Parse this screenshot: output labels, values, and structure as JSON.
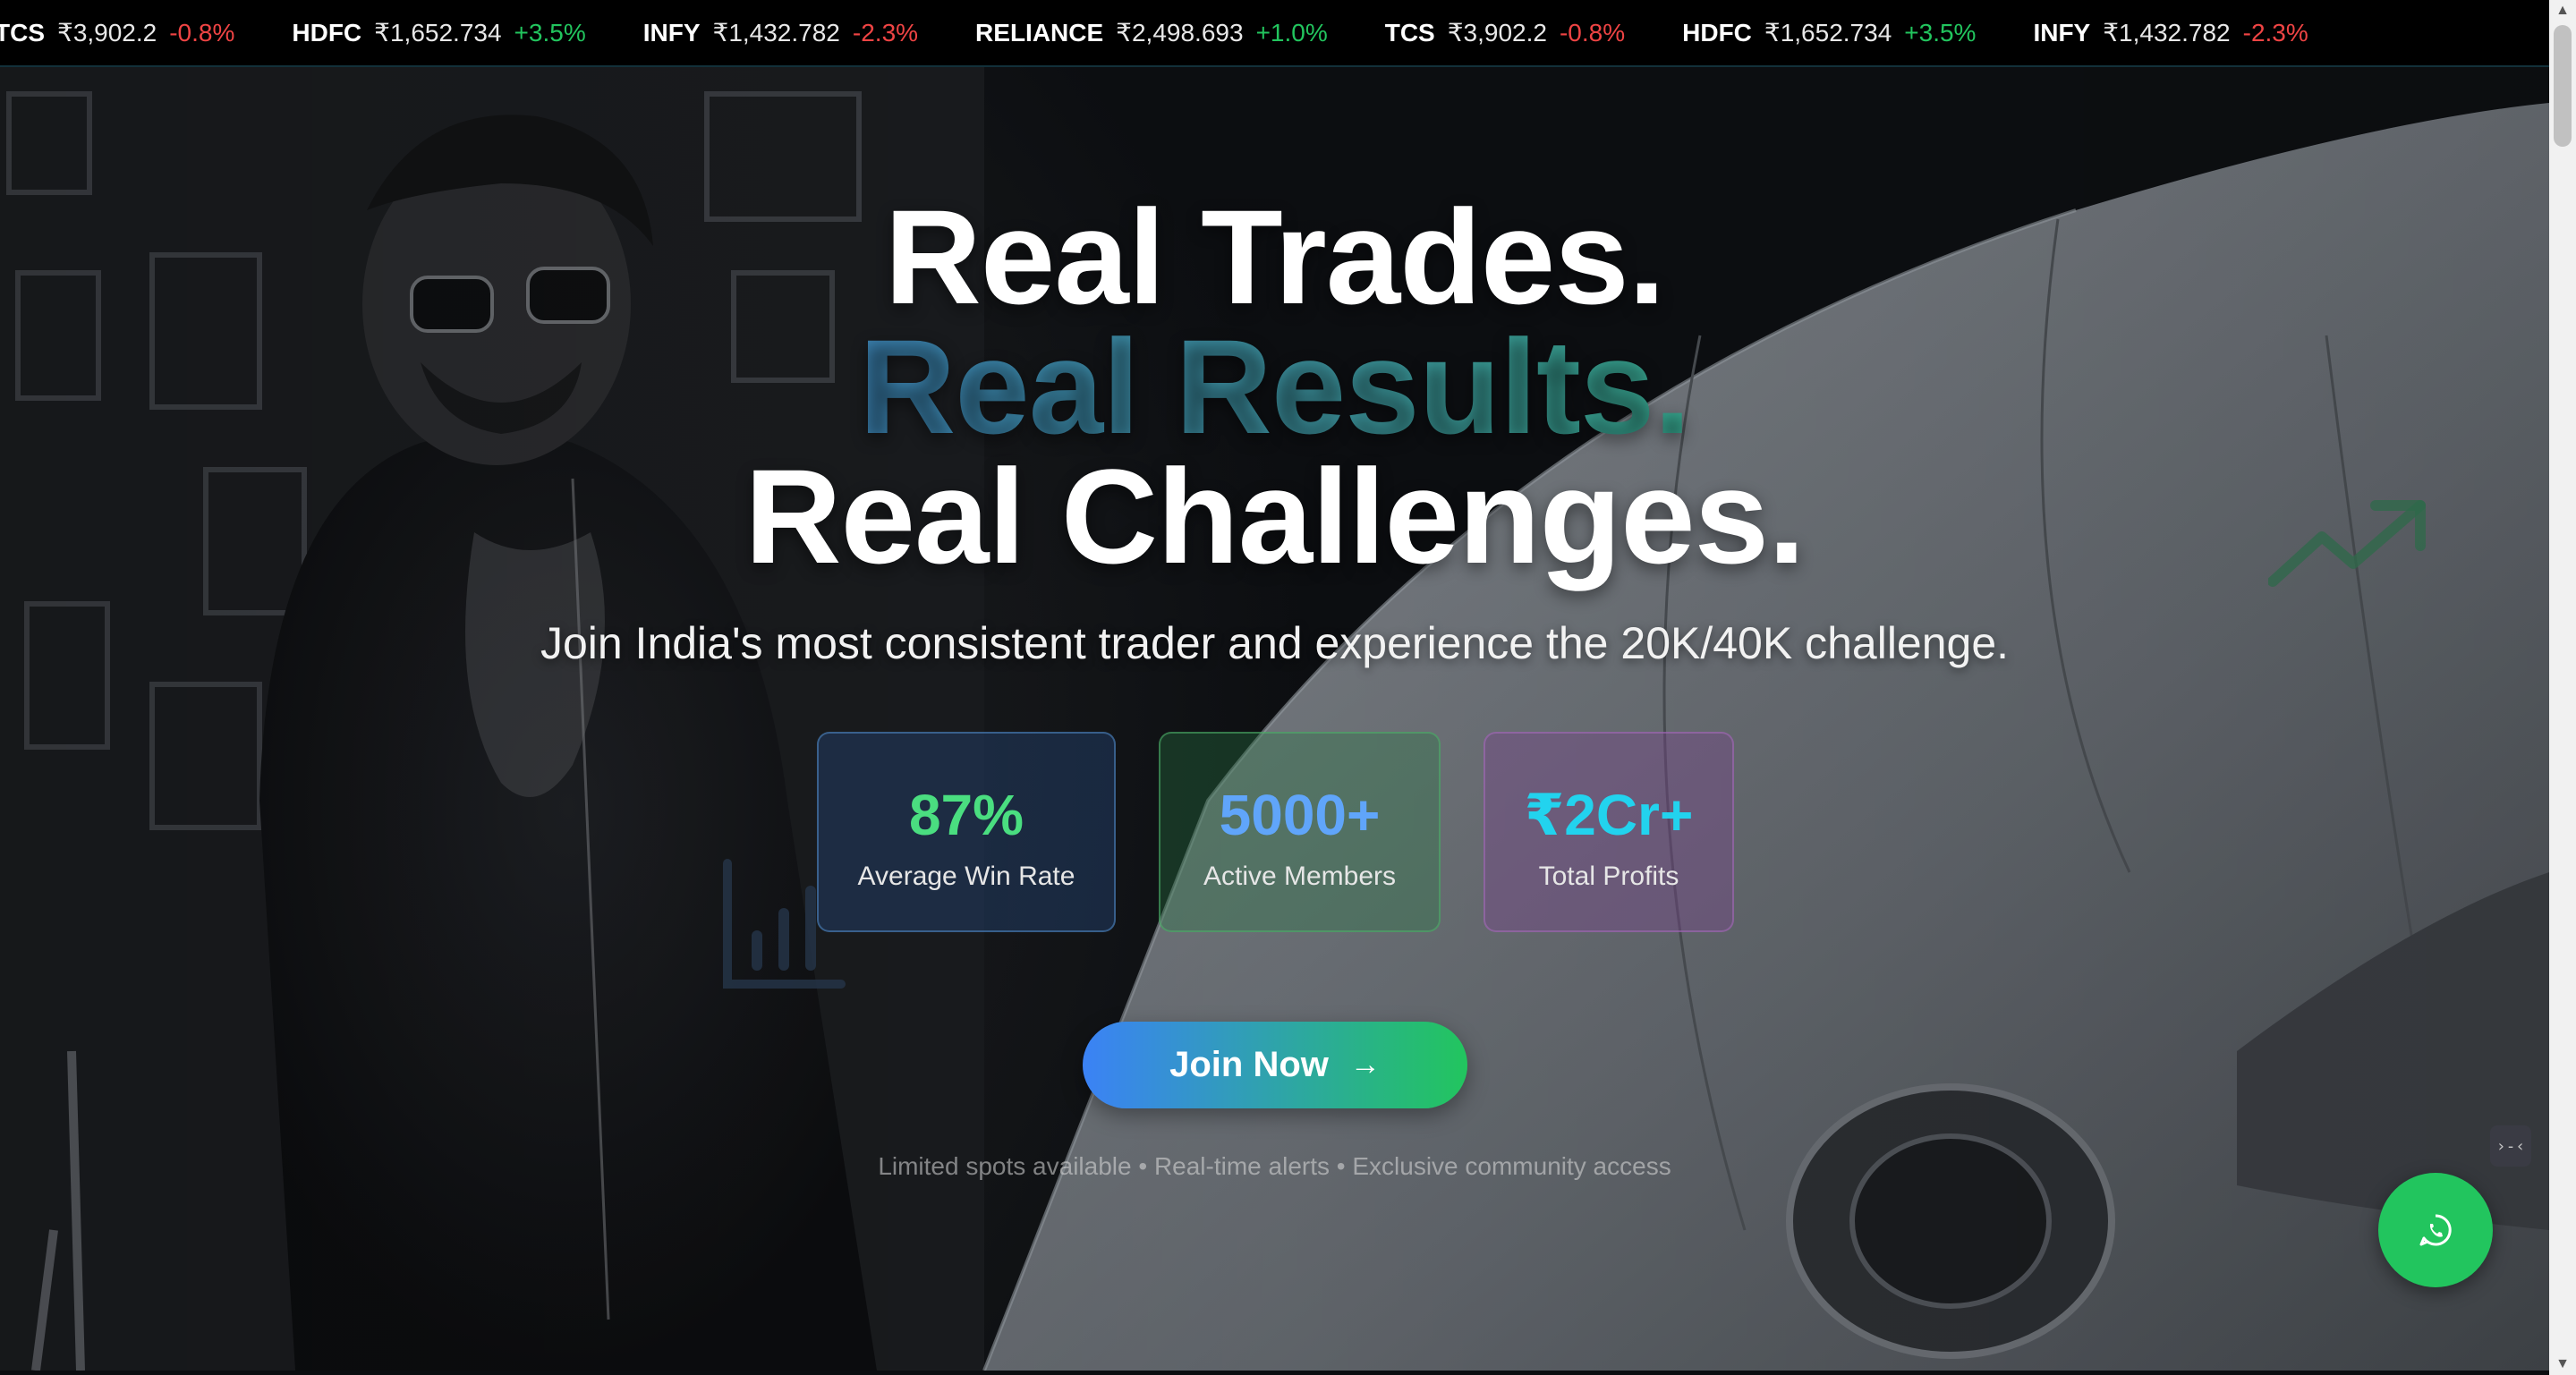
{
  "ticker": {
    "items": [
      {
        "symbol": "TCS",
        "price": "₹3,902.2",
        "change": "-0.8%",
        "direction": "down"
      },
      {
        "symbol": "HDFC",
        "price": "₹1,652.734",
        "change": "+3.5%",
        "direction": "up"
      },
      {
        "symbol": "INFY",
        "price": "₹1,432.782",
        "change": "-2.3%",
        "direction": "down"
      },
      {
        "symbol": "RELIANCE",
        "price": "₹2,498.693",
        "change": "+1.0%",
        "direction": "up"
      },
      {
        "symbol": "TCS",
        "price": "₹3,902.2",
        "change": "-0.8%",
        "direction": "down"
      },
      {
        "symbol": "HDFC",
        "price": "₹1,652.734",
        "change": "+3.5%",
        "direction": "up"
      },
      {
        "symbol": "INFY",
        "price": "₹1,432.782",
        "change": "-2.3%",
        "direction": "down"
      }
    ],
    "colors": {
      "up": "#22c55e",
      "down": "#ef4444"
    }
  },
  "hero": {
    "headline_line1": "Real Trades.",
    "headline_line2": "Real Results.",
    "headline_line3": "Real Challenges.",
    "subheadline": "Join India's most consistent trader and experience the 20K/40K challenge.",
    "stats": [
      {
        "value": "87%",
        "label": "Average Win Rate",
        "color": "#4ade80"
      },
      {
        "value": "5000+",
        "label": "Active Members",
        "color": "#60a5fa"
      },
      {
        "value": "₹2Cr+",
        "label": "Total Profits",
        "color": "#22d3ee"
      }
    ],
    "cta": {
      "label": "Join Now",
      "icon": "arrow-right-icon"
    },
    "footnote": "Limited spots available • Real-time alerts • Exclusive community access"
  },
  "floating": {
    "whatsapp_icon": "whatsapp-icon",
    "code_badge": "›-‹"
  },
  "decor_icons": [
    "trending-up-icon",
    "bar-chart-icon"
  ],
  "theme": {
    "accent_blue": "#3b82f6",
    "accent_green": "#22c55e"
  }
}
